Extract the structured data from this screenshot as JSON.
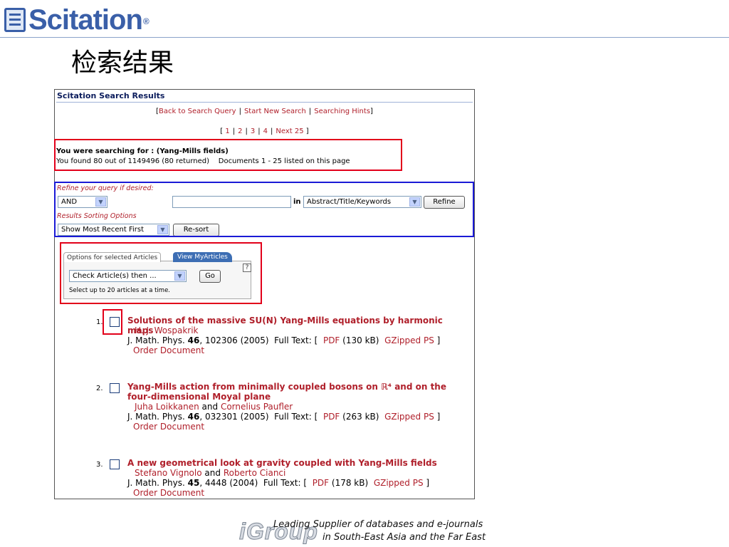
{
  "header": {
    "logo_text": "Scitation",
    "registered_mark": "®",
    "slide_title": "检索结果"
  },
  "panel": {
    "title": "Scitation Search Results",
    "nav_links": [
      "Back to Search Query",
      "Start New Search",
      "Searching Hints"
    ],
    "pages": [
      "1",
      "2",
      "3",
      "4",
      "Next 25"
    ],
    "search_label": "You were searching for : (Yang-Mills fields)",
    "found_text": "You found 80 out of 1149496 (80 returned)    Documents 1 - 25 listed on this page",
    "refine_label": "Refine your query if desired:",
    "operator_value": "AND",
    "query_value": "",
    "in_label": "in",
    "field_value": "Abstract/Title/Keywords",
    "refine_button": "Refine",
    "sorting_label": "Results Sorting Options",
    "sort_value": "Show Most Recent First",
    "resort_button": "Re-sort",
    "options_tab": "Options for selected Articles",
    "myarticles_tab": "View MyArticles",
    "help_symbol": "?",
    "action_value": "Check Article(s) then ...",
    "go_button": "Go",
    "limit_note": "Select up to 20 articles at a time."
  },
  "results": [
    {
      "number": "1.",
      "title": "Solutions of the massive SU(N) Yang-Mills equations by harmonic maps",
      "authors": [
        "H. J. Wospakrik"
      ],
      "journal": "J. Math. Phys.",
      "volume": "46",
      "citation": ", 102306 (2005)",
      "fulltext_label": "Full Text: [",
      "pdf_label": "PDF",
      "pdf_size": "(130 kB)",
      "gzip_label": "GZipped PS",
      "close_bracket": "]",
      "order_label": "Order Document"
    },
    {
      "number": "2.",
      "title": "Yang-Mills action from minimally coupled bosons on ℝ⁴ and on the four-dimensional Moyal plane",
      "authors": [
        "Juha Loikkanen",
        "Cornelius Paufler"
      ],
      "and_word": "and",
      "journal": "J. Math. Phys.",
      "volume": "46",
      "citation": ", 032301 (2005)",
      "fulltext_label": "Full Text: [",
      "pdf_label": "PDF",
      "pdf_size": "(263 kB)",
      "gzip_label": "GZipped PS",
      "close_bracket": "]",
      "order_label": "Order Document"
    },
    {
      "number": "3.",
      "title": "A new geometrical look at gravity coupled with Yang-Mills fields",
      "authors": [
        "Stefano Vignolo",
        "Roberto Cianci"
      ],
      "and_word": "and",
      "journal": "J. Math. Phys.",
      "volume": "45",
      "citation": ", 4448 (2004)",
      "fulltext_label": "Full Text: [",
      "pdf_label": "PDF",
      "pdf_size": "(178 kB)",
      "gzip_label": "GZipped PS",
      "close_bracket": "]",
      "order_label": "Order Document"
    }
  ],
  "footer": {
    "logo": "iGroup",
    "line1": "Leading Supplier of databases and e-journals",
    "line2": "in South-East Asia and the Far East"
  },
  "colors": {
    "link": "#b0202b",
    "annotation_red": "#e2001a",
    "annotation_blue": "#1a1ad6",
    "brand": "#3a5fa8"
  }
}
